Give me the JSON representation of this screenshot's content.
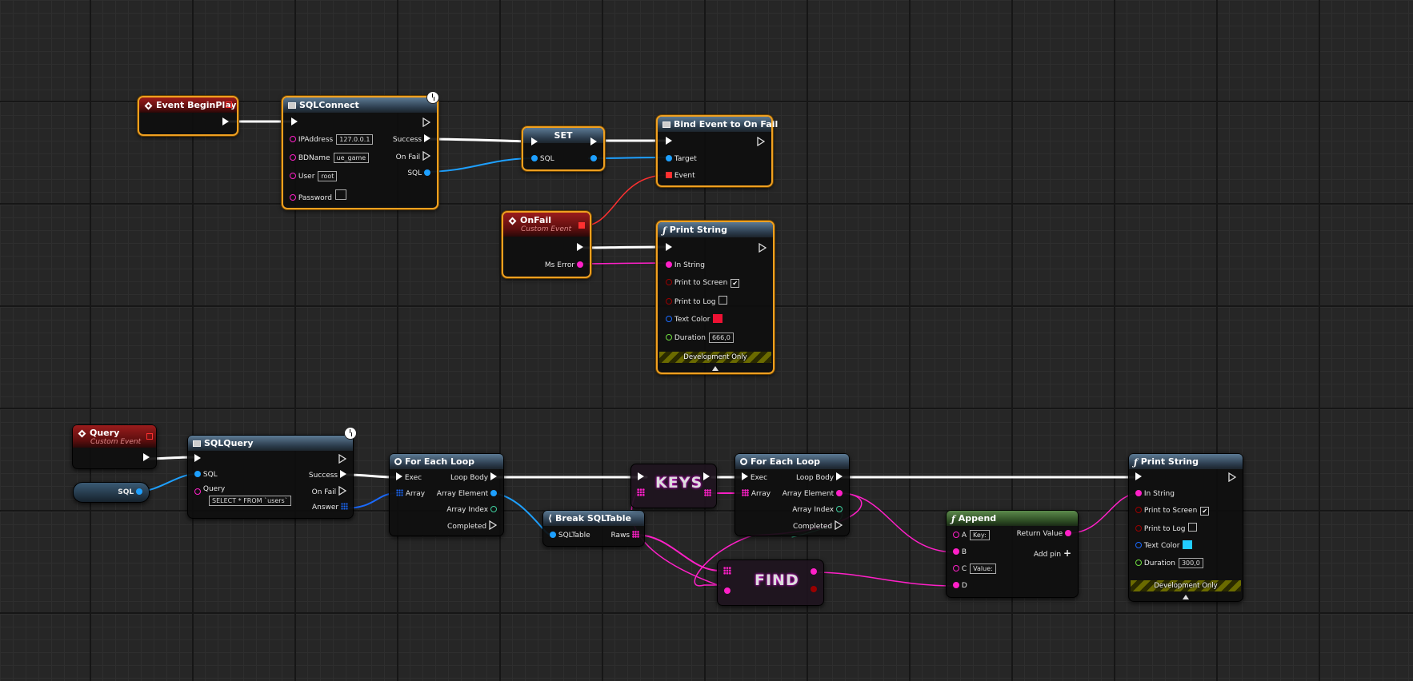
{
  "colors": {
    "exec": "#ffffff",
    "object": "#1ea0ff",
    "string": "#ff20c8",
    "bool": "#9a0000",
    "linearcolor": "#1a6aff",
    "float": "#70e040",
    "event": "#ff3030",
    "selection": "#f0a020"
  },
  "nodes": {
    "event_begin_play": {
      "title": "Event BeginPlay"
    },
    "sql_connect": {
      "title": "SQLConnect",
      "pins": {
        "ip": "IPAddress",
        "ip_value": "127.0.0.1",
        "bd": "BDName",
        "bd_value": "ue_game",
        "user": "User",
        "user_value": "root",
        "password": "Password",
        "success": "Success",
        "onfail": "On Fail",
        "sql": "SQL"
      }
    },
    "set": {
      "title": "SET",
      "pins": {
        "sql": "SQL"
      }
    },
    "bind_event": {
      "title": "Bind Event to On Fail",
      "pins": {
        "target": "Target",
        "event": "Event"
      }
    },
    "onfail": {
      "title": "OnFail",
      "subtitle": "Custom Event",
      "pins": {
        "ms_error": "Ms Error"
      }
    },
    "print_string_1": {
      "title": "Print String",
      "pins": {
        "in_string": "In String",
        "print_screen": "Print to Screen",
        "print_log": "Print to Log",
        "text_color": "Text Color",
        "duration": "Duration",
        "duration_value": "666,0"
      },
      "text_color_swatch": "#ee1133",
      "dev": "Development Only"
    },
    "query": {
      "title": "Query",
      "subtitle": "Custom Event"
    },
    "sql_var": {
      "label": "SQL"
    },
    "sql_query": {
      "title": "SQLQuery",
      "pins": {
        "sql": "SQL",
        "query": "Query",
        "query_value": "SELECT * FROM `users`",
        "success": "Success",
        "onfail": "On Fail",
        "answer": "Answer"
      }
    },
    "for_each_1": {
      "title": "For Each Loop",
      "pins": {
        "exec": "Exec",
        "array": "Array",
        "loop_body": "Loop Body",
        "array_element": "Array Element",
        "array_index": "Array Index",
        "completed": "Completed"
      }
    },
    "break_sql": {
      "title": "Break SQLTable",
      "pins": {
        "sqltable": "SQLTable",
        "raws": "Raws"
      }
    },
    "keys": {
      "label": "KEYS"
    },
    "find": {
      "label": "FIND"
    },
    "for_each_2": {
      "title": "For Each Loop",
      "pins": {
        "exec": "Exec",
        "array": "Array",
        "loop_body": "Loop Body",
        "array_element": "Array Element",
        "array_index": "Array Index",
        "completed": "Completed"
      }
    },
    "append": {
      "title": "Append",
      "pins": {
        "a": "A",
        "a_value": "Key:",
        "b": "B",
        "c": "C",
        "c_value": "Value:",
        "d": "D",
        "return_value": "Return Value",
        "add_pin": "Add pin"
      }
    },
    "print_string_2": {
      "title": "Print String",
      "pins": {
        "in_string": "In String",
        "print_screen": "Print to Screen",
        "print_log": "Print to Log",
        "text_color": "Text Color",
        "duration": "Duration",
        "duration_value": "300,0"
      },
      "text_color_swatch": "#22ccff",
      "dev": "Development Only"
    }
  }
}
